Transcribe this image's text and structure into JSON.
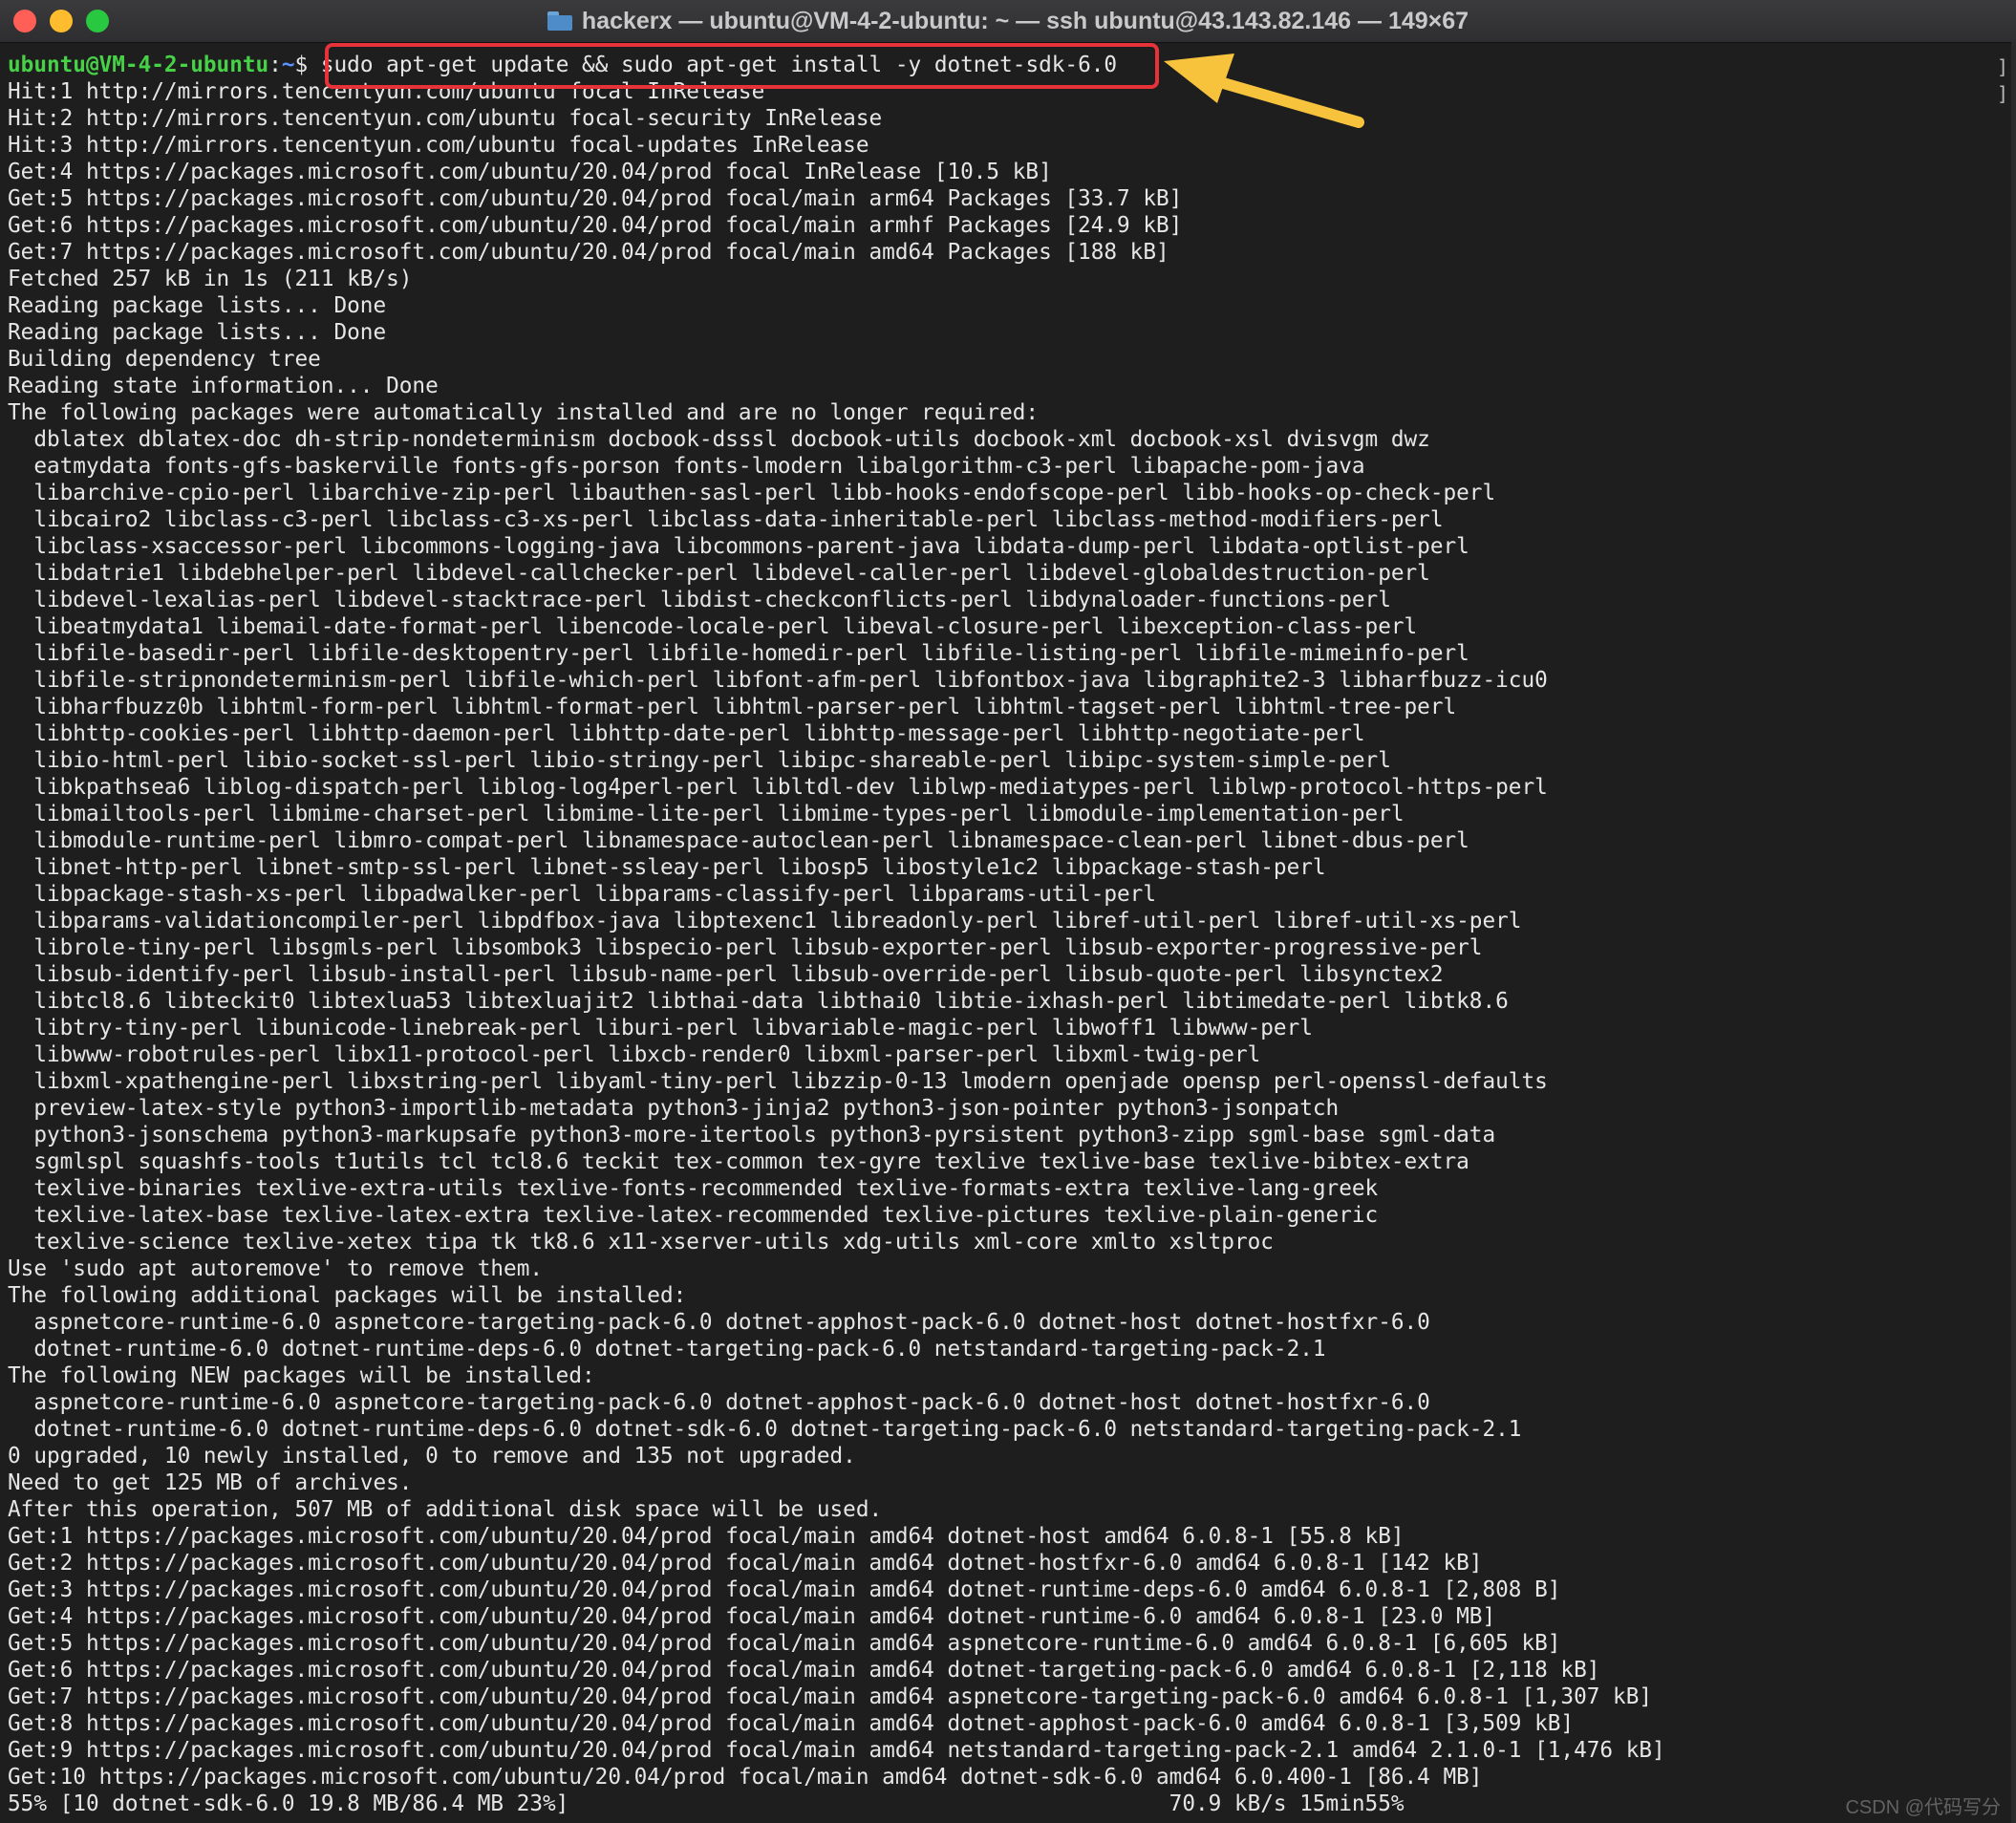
{
  "window": {
    "title": "hackerx — ubuntu@VM-4-2-ubuntu: ~ — ssh ubuntu@43.143.82.146 — 149×67",
    "icon": "folder-icon"
  },
  "prompt": {
    "user_host": "ubuntu@VM-4-2-ubuntu",
    "colon": ":",
    "path": "~",
    "symbol": "$ ",
    "command": "sudo apt-get update && sudo apt-get install -y dotnet-sdk-6.0"
  },
  "output": [
    "Hit:1 http://mirrors.tencentyun.com/ubuntu focal InRelease",
    "Hit:2 http://mirrors.tencentyun.com/ubuntu focal-security InRelease",
    "Hit:3 http://mirrors.tencentyun.com/ubuntu focal-updates InRelease",
    "Get:4 https://packages.microsoft.com/ubuntu/20.04/prod focal InRelease [10.5 kB]",
    "Get:5 https://packages.microsoft.com/ubuntu/20.04/prod focal/main arm64 Packages [33.7 kB]",
    "Get:6 https://packages.microsoft.com/ubuntu/20.04/prod focal/main armhf Packages [24.9 kB]",
    "Get:7 https://packages.microsoft.com/ubuntu/20.04/prod focal/main amd64 Packages [188 kB]",
    "Fetched 257 kB in 1s (211 kB/s)",
    "Reading package lists... Done",
    "Reading package lists... Done",
    "Building dependency tree",
    "Reading state information... Done",
    "The following packages were automatically installed and are no longer required:",
    "  dblatex dblatex-doc dh-strip-nondeterminism docbook-dsssl docbook-utils docbook-xml docbook-xsl dvisvgm dwz",
    "  eatmydata fonts-gfs-baskerville fonts-gfs-porson fonts-lmodern libalgorithm-c3-perl libapache-pom-java",
    "  libarchive-cpio-perl libarchive-zip-perl libauthen-sasl-perl libb-hooks-endofscope-perl libb-hooks-op-check-perl",
    "  libcairo2 libclass-c3-perl libclass-c3-xs-perl libclass-data-inheritable-perl libclass-method-modifiers-perl",
    "  libclass-xsaccessor-perl libcommons-logging-java libcommons-parent-java libdata-dump-perl libdata-optlist-perl",
    "  libdatrie1 libdebhelper-perl libdevel-callchecker-perl libdevel-caller-perl libdevel-globaldestruction-perl",
    "  libdevel-lexalias-perl libdevel-stacktrace-perl libdist-checkconflicts-perl libdynaloader-functions-perl",
    "  libeatmydata1 libemail-date-format-perl libencode-locale-perl libeval-closure-perl libexception-class-perl",
    "  libfile-basedir-perl libfile-desktopentry-perl libfile-homedir-perl libfile-listing-perl libfile-mimeinfo-perl",
    "  libfile-stripnondeterminism-perl libfile-which-perl libfont-afm-perl libfontbox-java libgraphite2-3 libharfbuzz-icu0",
    "  libharfbuzz0b libhtml-form-perl libhtml-format-perl libhtml-parser-perl libhtml-tagset-perl libhtml-tree-perl",
    "  libhttp-cookies-perl libhttp-daemon-perl libhttp-date-perl libhttp-message-perl libhttp-negotiate-perl",
    "  libio-html-perl libio-socket-ssl-perl libio-stringy-perl libipc-shareable-perl libipc-system-simple-perl",
    "  libkpathsea6 liblog-dispatch-perl liblog-log4perl-perl libltdl-dev liblwp-mediatypes-perl liblwp-protocol-https-perl",
    "  libmailtools-perl libmime-charset-perl libmime-lite-perl libmime-types-perl libmodule-implementation-perl",
    "  libmodule-runtime-perl libmro-compat-perl libnamespace-autoclean-perl libnamespace-clean-perl libnet-dbus-perl",
    "  libnet-http-perl libnet-smtp-ssl-perl libnet-ssleay-perl libosp5 libostyle1c2 libpackage-stash-perl",
    "  libpackage-stash-xs-perl libpadwalker-perl libparams-classify-perl libparams-util-perl",
    "  libparams-validationcompiler-perl libpdfbox-java libptexenc1 libreadonly-perl libref-util-perl libref-util-xs-perl",
    "  librole-tiny-perl libsgmls-perl libsombok3 libspecio-perl libsub-exporter-perl libsub-exporter-progressive-perl",
    "  libsub-identify-perl libsub-install-perl libsub-name-perl libsub-override-perl libsub-quote-perl libsynctex2",
    "  libtcl8.6 libteckit0 libtexlua53 libtexluajit2 libthai-data libthai0 libtie-ixhash-perl libtimedate-perl libtk8.6",
    "  libtry-tiny-perl libunicode-linebreak-perl liburi-perl libvariable-magic-perl libwoff1 libwww-perl",
    "  libwww-robotrules-perl libx11-protocol-perl libxcb-render0 libxml-parser-perl libxml-twig-perl",
    "  libxml-xpathengine-perl libxstring-perl libyaml-tiny-perl libzzip-0-13 lmodern openjade opensp perl-openssl-defaults",
    "  preview-latex-style python3-importlib-metadata python3-jinja2 python3-json-pointer python3-jsonpatch",
    "  python3-jsonschema python3-markupsafe python3-more-itertools python3-pyrsistent python3-zipp sgml-base sgml-data",
    "  sgmlspl squashfs-tools t1utils tcl tcl8.6 teckit tex-common tex-gyre texlive texlive-base texlive-bibtex-extra",
    "  texlive-binaries texlive-extra-utils texlive-fonts-recommended texlive-formats-extra texlive-lang-greek",
    "  texlive-latex-base texlive-latex-extra texlive-latex-recommended texlive-pictures texlive-plain-generic",
    "  texlive-science texlive-xetex tipa tk tk8.6 x11-xserver-utils xdg-utils xml-core xmlto xsltproc",
    "Use 'sudo apt autoremove' to remove them.",
    "The following additional packages will be installed:",
    "  aspnetcore-runtime-6.0 aspnetcore-targeting-pack-6.0 dotnet-apphost-pack-6.0 dotnet-host dotnet-hostfxr-6.0",
    "  dotnet-runtime-6.0 dotnet-runtime-deps-6.0 dotnet-targeting-pack-6.0 netstandard-targeting-pack-2.1",
    "The following NEW packages will be installed:",
    "  aspnetcore-runtime-6.0 aspnetcore-targeting-pack-6.0 dotnet-apphost-pack-6.0 dotnet-host dotnet-hostfxr-6.0",
    "  dotnet-runtime-6.0 dotnet-runtime-deps-6.0 dotnet-sdk-6.0 dotnet-targeting-pack-6.0 netstandard-targeting-pack-2.1",
    "0 upgraded, 10 newly installed, 0 to remove and 135 not upgraded.",
    "Need to get 125 MB of archives.",
    "After this operation, 507 MB of additional disk space will be used.",
    "Get:1 https://packages.microsoft.com/ubuntu/20.04/prod focal/main amd64 dotnet-host amd64 6.0.8-1 [55.8 kB]",
    "Get:2 https://packages.microsoft.com/ubuntu/20.04/prod focal/main amd64 dotnet-hostfxr-6.0 amd64 6.0.8-1 [142 kB]",
    "Get:3 https://packages.microsoft.com/ubuntu/20.04/prod focal/main amd64 dotnet-runtime-deps-6.0 amd64 6.0.8-1 [2,808 B]",
    "Get:4 https://packages.microsoft.com/ubuntu/20.04/prod focal/main amd64 dotnet-runtime-6.0 amd64 6.0.8-1 [23.0 MB]",
    "Get:5 https://packages.microsoft.com/ubuntu/20.04/prod focal/main amd64 aspnetcore-runtime-6.0 amd64 6.0.8-1 [6,605 kB]",
    "Get:6 https://packages.microsoft.com/ubuntu/20.04/prod focal/main amd64 dotnet-targeting-pack-6.0 amd64 6.0.8-1 [2,118 kB]",
    "Get:7 https://packages.microsoft.com/ubuntu/20.04/prod focal/main amd64 aspnetcore-targeting-pack-6.0 amd64 6.0.8-1 [1,307 kB]",
    "Get:8 https://packages.microsoft.com/ubuntu/20.04/prod focal/main amd64 dotnet-apphost-pack-6.0 amd64 6.0.8-1 [3,509 kB]",
    "Get:9 https://packages.microsoft.com/ubuntu/20.04/prod focal/main amd64 netstandard-targeting-pack-2.1 amd64 2.1.0-1 [1,476 kB]",
    "Get:10 https://packages.microsoft.com/ubuntu/20.04/prod focal/main amd64 dotnet-sdk-6.0 amd64 6.0.400-1 [86.4 MB]",
    "55% [10 dotnet-sdk-6.0 19.8 MB/86.4 MB 23%]                                              70.9 kB/s 15min55%"
  ],
  "scroll_marks": [
    "]",
    "]"
  ],
  "watermark": "CSDN @代码写分"
}
